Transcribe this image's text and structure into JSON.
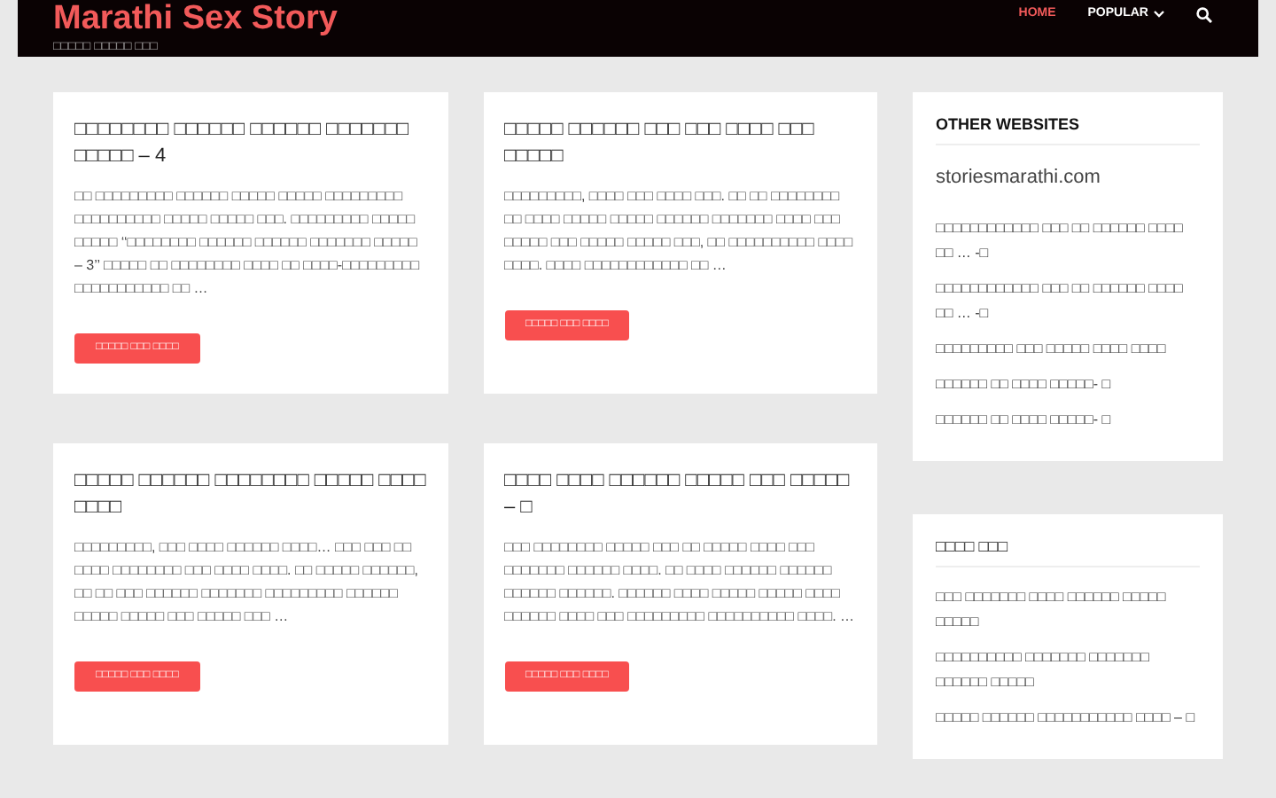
{
  "header": {
    "site_title": "Marathi Sex Story",
    "tagline": "□□□□□ □□□□□ □□□",
    "nav": [
      {
        "label": "HOME",
        "selected": true,
        "kind": "link"
      },
      {
        "label": "POPULAR",
        "selected": false,
        "kind": "dropdown"
      }
    ]
  },
  "posts": [
    {
      "title": "□□□□□□□□ □□□□□□ □□□□□□ □□□□□□□ □□□□□ – 4",
      "excerpt": "□□ □□□□□□□□□ □□□□□□ □□□□□ □□□□□ □□□□□□□□□ □□□□□□□□□□ □□□□□ □□□□□ □□□. □□□□□□□□□ □□□□□ □□□□□ ‘‘□□□□□□□□ □□□□□□ □□□□□□ □□□□□□□ □□□□□ – 3’’ □□□□□ □□ □□□□□□□□ □□□□ □□ □□□□-□□□□□□□□□ □□□□□□□□□□□ □□ …",
      "button": "□□□□□ □□□ □□□□"
    },
    {
      "title": "□□□□□ □□□□□□ □□□ □□□ □□□□ □□□ □□□□□",
      "excerpt": "□□□□□□□□□, □□□□ □□□ □□□□ □□□. □□ □□ □□□□□□□□ □□ □□□□ □□□□□ □□□□□ □□□□□□ □□□□□□□ □□□□ □□□ □□□□□ □□□ □□□□□ □□□□□ □□□, □□ □□□□□□□□□□ □□□□ □□□□. □□□□ □□□□□□□□□□□□ □□ …",
      "button": "□□□□□ □□□ □□□□"
    },
    {
      "title": "□□□□□ □□□□□□ □□□□□□□□ □□□□□ □□□□ □□□□",
      "excerpt": "□□□□□□□□□, □□□ □□□□ □□□□□□ □□□□… □□□ □□□ □□ □□□□ □□□□□□□□ □□□ □□□□ □□□□. □□ □□□□□ □□□□□□, □□ □□ □□□ □□□□□□ □□□□□□□ □□□□□□□□□ □□□□□□ □□□□□ □□□□□ □□□ □□□□□ □□□ …",
      "button": "□□□□□ □□□ □□□□"
    },
    {
      "title": "□□□□ □□□□ □□□□□□ □□□□□ □□□ □□□□□ – □",
      "excerpt": "□□□ □□□□□□□□ □□□□□ □□□ □□ □□□□□ □□□□ □□□ □□□□□□□ □□□□□□ □□□□. □□ □□□□ □□□□□□ □□□□□□ □□□□□□ □□□□□□. □□□□□□ □□□□ □□□□□ □□□□□ □□□□ □□□□□□ □□□□ □□□ □□□□□□□□□ □□□□□□□□□□ □□□□. …",
      "button": "□□□□□ □□□ □□□□"
    }
  ],
  "sidebar": [
    {
      "heading": "OTHER WEBSITES",
      "site": "storiesmarathi.com",
      "links": [
        "□□□□□□□□□□□□ □□□ □□ □□□□□□ □□□□ □□ … -□",
        "□□□□□□□□□□□□ □□□ □□ □□□□□□ □□□□ □□ … -□",
        "□□□□□□□□□ □□□ □□□□□ □□□□ □□□□",
        "□□□□□□ □□ □□□□ □□□□□- □",
        "□□□□□□ □□ □□□□ □□□□□- □"
      ]
    },
    {
      "heading": "□□□□ □□□",
      "links": [
        "□□□ □□□□□□□ □□□□ □□□□□□ □□□□□ □□□□□",
        "□□□□□□□□□□ □□□□□□□ □□□□□□□ □□□□□□ □□□□□",
        "□□□□□ □□□□□□ □□□□□□□□□□□ □□□□ – □"
      ]
    }
  ]
}
